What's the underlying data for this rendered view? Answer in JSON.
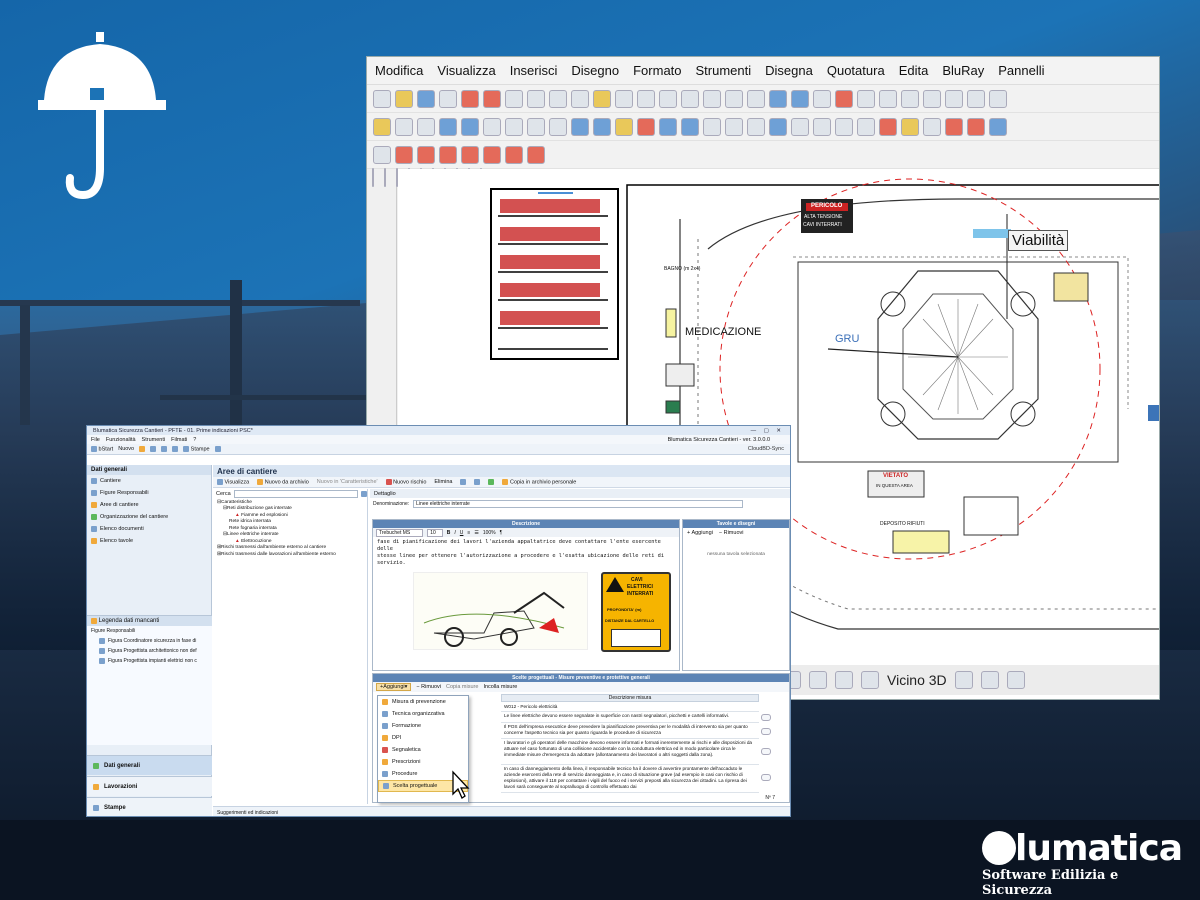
{
  "brand": {
    "name": "blumatica",
    "tagline": "Software Edilizia e Sicurezza"
  },
  "cad": {
    "menu": [
      "Modifica",
      "Visualizza",
      "Inserisci",
      "Disegno",
      "Formato",
      "Strumenti",
      "Disegna",
      "Quotatura",
      "Edita",
      "BluRay",
      "Pannelli"
    ],
    "labels": {
      "viabilita": "Viabilità",
      "gru": "GRU",
      "medicazione": "MEDICAZIONE",
      "bagno": "BAGNO (m 2x4)",
      "pericolo_1": "PERICOLO",
      "pericolo_2": "ALTA TENSIONE",
      "pericolo_3": "CAVI INTERRATI",
      "vietato": "VIETATO",
      "vietato_sub": "IN QUESTA AREA",
      "deposito": "DEPOSITO RIFIUTI"
    },
    "bottom_label": "Vicino 3D"
  },
  "app": {
    "title": "Blumatica Sicurezza Cantieri - PFTE - 01. Prime indicazioni PSC*",
    "title_right": "Blumatica Sicurezza Cantieri - ver. 3.0.0.0",
    "menu": [
      "File",
      "Funzionalità",
      "Strumenti",
      "Filmati",
      "?"
    ],
    "toolbar": [
      "bStart",
      "Nuovo",
      "Stampe"
    ],
    "cloud_label": "CloudBD-Sync",
    "sidebar": {
      "header": "Dati generali",
      "items": [
        "Cantiere",
        "Figure Responsabili",
        "Aree di cantiere",
        "Organizzazione del cantiere",
        "Elenco documenti",
        "Elenco tavole"
      ],
      "legend_header": "Legenda dati mancanti",
      "legend_group": "Figure Responsabili",
      "legend_items": [
        "Figura Coordinatore sicurezza in fase di",
        "Figura Progettista architettonico non def",
        "Figura Progettista impianti elettrici non c"
      ],
      "nav": [
        "Dati generali",
        "Lavorazioni",
        "Stampe"
      ]
    },
    "main": {
      "title": "Aree di cantiere",
      "toolbar": [
        "Visualizza",
        "Nuovo da archivio",
        "Nuovo in 'Caratteristiche'",
        "Nuovo rischio",
        "Elimina",
        "Copia in archivio personale"
      ],
      "search_label": "Cerca",
      "tree": [
        {
          "level": 0,
          "text": "Caratteristiche"
        },
        {
          "level": 1,
          "text": "Reti distribuzione gas interrate"
        },
        {
          "level": 2,
          "text": "Fiamme ed esplosioni"
        },
        {
          "level": 1,
          "text": "Rete idrica interrata"
        },
        {
          "level": 1,
          "text": "Rete fognaria interrata"
        },
        {
          "level": 1,
          "text": "Linee elettriche interrate"
        },
        {
          "level": 2,
          "text": "Elettrocuzione"
        },
        {
          "level": 0,
          "text": "Rischi trasmessi dall'ambiente esterno al cantiere"
        },
        {
          "level": 0,
          "text": "Rischi trasmessi dalle lavorazioni all'ambiente esterno"
        }
      ],
      "detail_tab": "Dettaglio",
      "denominazione_label": "Denominazione:",
      "denominazione_value": "Linee elettriche interrate",
      "descrizione_header": "Descrizione",
      "font_name": "Trebuchet MS",
      "font_size": "10",
      "zoom": "100%",
      "desc_lines": [
        "fase di pianificazione dei lavori l'azienda appaltatrice deve contattare l'ente esercente delle",
        "stesse linee per ottenere l'autorizzazione a procedere e l'esatta ubicazione delle reti di servizio."
      ],
      "sign": {
        "l1": "CAVI",
        "l2": "ELETTRICI",
        "l3": "INTERRATI",
        "l4": "PROFONDITA' (m)",
        "l5": "DISTANZE DAL CARTELLO"
      },
      "tavole_header": "Tavole e disegni",
      "tavole_add": "Aggiungi",
      "tavole_remove": "Rimuovi",
      "tavole_empty": "nessuna tavola selezionata",
      "scelte_header": "Scelte progettuali - Misure preventive e protettive generali",
      "scelte_toolbar": [
        "Aggiungi",
        "Rimuovi",
        "Copia misure",
        "Incolla misure"
      ],
      "col_descrizione": "Descrizione misura",
      "misure": [
        "W012 - Pericolo elettricità",
        "Le linee elettriche devono essere segnalate in superficie con nastri segnalatori, picchetti e cartelli informativi.",
        "Il POS dell'impresa esecutrice deve prevedere la pianificazione preventiva per le modalità di intervento sia per quanto concerne l'aspetto tecnico sia per quanto riguarda le procedure di sicurezza",
        "I lavoratori e gli operatori delle macchine devono essere informati e formati inerentemente ai rischi e alle disposizioni da attuare nel caso fortunato di una collisione accidentale con la conduttura elettrica ed in modo particolare circa le immediate misure d'emergenza da adottare (allontanamento dei lavoratori o altri soggetti dalla zona).",
        "In caso di danneggiamento della linea, il responsabile tecnico ha il dovere di avvertire prontamente dell'accaduto le aziende esercenti della rete di servizio danneggiata e, in caso di situazione grave (ad esempio in casi con rischio di esplosioni), attivare il 118 per contattare i vigili del fuoco ed i servizi preposti alla sicurezza dei cittadini. La ripresa dei lavori sarà conseguente al sopralluogo di controllo effettuato dai"
      ],
      "count": "Nº 7",
      "dropdown": [
        "Misura di prevenzione",
        "Tecnica organizzativa",
        "Formazione",
        "DPI",
        "Segnaletica",
        "Prescrizioni",
        "Procedure",
        "Scelta progettuale"
      ],
      "status": "Suggerimenti ed indicazioni"
    }
  },
  "colors": {
    "accent": "#1c73b6",
    "highlight": "#fde6a6",
    "sign_yellow": "#f6b400",
    "header_blue": "#5c84b5"
  }
}
